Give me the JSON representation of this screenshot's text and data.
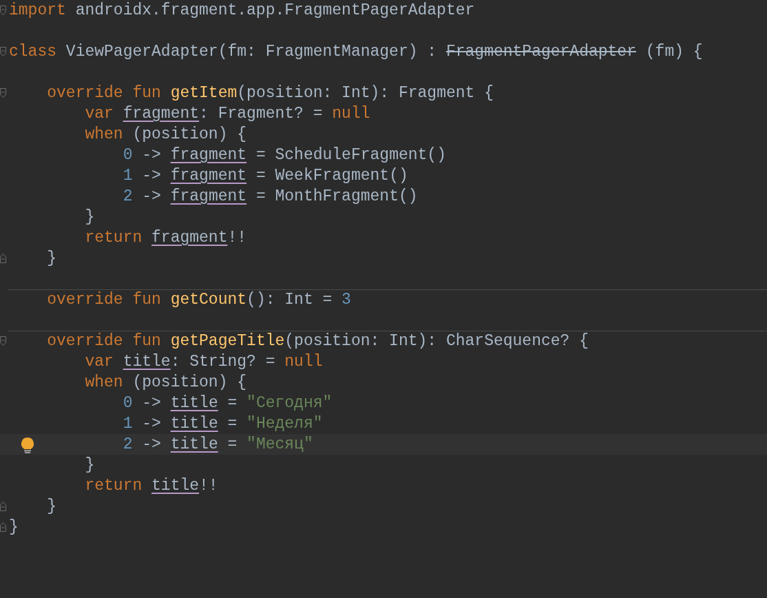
{
  "editor": {
    "lines": [
      {
        "fold_start": true,
        "tokens": [
          {
            "kind": "keyword",
            "text": "import "
          },
          {
            "kind": "plain",
            "text": "androidx.fragment.app.FragmentPagerAdapter"
          }
        ]
      },
      {
        "blank_line_before": true,
        "fold_start": true,
        "tokens": [
          {
            "kind": "keyword",
            "text": "class "
          },
          {
            "kind": "plain",
            "text": "ViewPagerAdapter(fm: FragmentManager) : "
          },
          {
            "kind": "deprecated",
            "text": "FragmentPagerAdapter"
          },
          {
            "kind": "plain",
            "text": " (fm) {"
          }
        ]
      },
      {
        "blank_line_before": true,
        "fold_start": true,
        "tokens": [
          {
            "kind": "keyword",
            "text": "    override fun "
          },
          {
            "kind": "function",
            "text": "getItem"
          },
          {
            "kind": "plain",
            "text": "(position: Int): Fragment {"
          }
        ]
      },
      {
        "tokens": [
          {
            "kind": "keyword",
            "text": "        var "
          },
          {
            "kind": "mutable",
            "text": "fragment"
          },
          {
            "kind": "plain",
            "text": ": Fragment? = "
          },
          {
            "kind": "keyword",
            "text": "null"
          }
        ]
      },
      {
        "tokens": [
          {
            "kind": "keyword",
            "text": "        when "
          },
          {
            "kind": "plain",
            "text": "(position) {"
          }
        ]
      },
      {
        "tokens": [
          {
            "kind": "number",
            "text": "            0"
          },
          {
            "kind": "plain",
            "text": " -> "
          },
          {
            "kind": "mutable",
            "text": "fragment"
          },
          {
            "kind": "plain",
            "text": " = ScheduleFragment()"
          }
        ]
      },
      {
        "tokens": [
          {
            "kind": "number",
            "text": "            1"
          },
          {
            "kind": "plain",
            "text": " -> "
          },
          {
            "kind": "mutable",
            "text": "fragment"
          },
          {
            "kind": "plain",
            "text": " = WeekFragment()"
          }
        ]
      },
      {
        "tokens": [
          {
            "kind": "number",
            "text": "            2"
          },
          {
            "kind": "plain",
            "text": " -> "
          },
          {
            "kind": "mutable",
            "text": "fragment"
          },
          {
            "kind": "plain",
            "text": " = MonthFragment()"
          }
        ]
      },
      {
        "tokens": [
          {
            "kind": "plain",
            "text": "        }"
          }
        ]
      },
      {
        "tokens": [
          {
            "kind": "keyword",
            "text": "        return "
          },
          {
            "kind": "mutable",
            "text": "fragment"
          },
          {
            "kind": "plain",
            "text": "!!"
          }
        ]
      },
      {
        "fold_end": true,
        "tokens": [
          {
            "kind": "plain",
            "text": "    }"
          }
        ]
      },
      {
        "blank_line_before": true,
        "separator_above": true,
        "tokens": [
          {
            "kind": "keyword",
            "text": "    override fun "
          },
          {
            "kind": "function",
            "text": "getCount"
          },
          {
            "kind": "plain",
            "text": "(): Int = "
          },
          {
            "kind": "number",
            "text": "3"
          }
        ]
      },
      {
        "blank_line_before": true,
        "separator_above": true,
        "fold_start": true,
        "tokens": [
          {
            "kind": "keyword",
            "text": "    override fun "
          },
          {
            "kind": "function",
            "text": "getPageTitle"
          },
          {
            "kind": "plain",
            "text": "(position: Int): CharSequence? {"
          }
        ]
      },
      {
        "tokens": [
          {
            "kind": "keyword",
            "text": "        var "
          },
          {
            "kind": "mutable",
            "text": "title"
          },
          {
            "kind": "plain",
            "text": ": String? = "
          },
          {
            "kind": "keyword",
            "text": "null"
          }
        ]
      },
      {
        "tokens": [
          {
            "kind": "keyword",
            "text": "        when "
          },
          {
            "kind": "plain",
            "text": "(position) {"
          }
        ]
      },
      {
        "tokens": [
          {
            "kind": "number",
            "text": "            0"
          },
          {
            "kind": "plain",
            "text": " -> "
          },
          {
            "kind": "mutable",
            "text": "title"
          },
          {
            "kind": "plain",
            "text": " = "
          },
          {
            "kind": "string",
            "text": "\"Сегодня\""
          }
        ]
      },
      {
        "tokens": [
          {
            "kind": "number",
            "text": "            1"
          },
          {
            "kind": "plain",
            "text": " -> "
          },
          {
            "kind": "mutable",
            "text": "title"
          },
          {
            "kind": "plain",
            "text": " = "
          },
          {
            "kind": "string",
            "text": "\"Неделя\""
          }
        ]
      },
      {
        "current": true,
        "bulb": true,
        "tokens": [
          {
            "kind": "number",
            "text": "            2"
          },
          {
            "kind": "plain",
            "text": " -> "
          },
          {
            "kind": "mutable",
            "text": "title"
          },
          {
            "kind": "plain",
            "text": " = "
          },
          {
            "kind": "string",
            "text": "\"Месяц\""
          }
        ]
      },
      {
        "tokens": [
          {
            "kind": "plain",
            "text": "        }"
          }
        ]
      },
      {
        "tokens": [
          {
            "kind": "keyword",
            "text": "        return "
          },
          {
            "kind": "mutable",
            "text": "title"
          },
          {
            "kind": "plain",
            "text": "!!"
          }
        ]
      },
      {
        "fold_end": true,
        "tokens": [
          {
            "kind": "plain",
            "text": "    }"
          }
        ]
      },
      {
        "fold_end": true,
        "tokens": [
          {
            "kind": "plain",
            "text": "}"
          }
        ]
      }
    ]
  }
}
